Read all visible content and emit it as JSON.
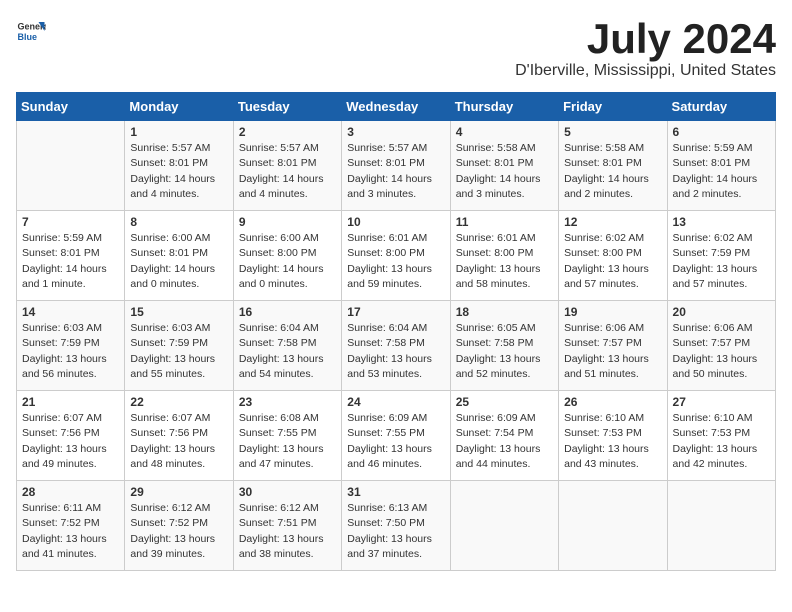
{
  "logo": {
    "general": "General",
    "blue": "Blue"
  },
  "header": {
    "title": "July 2024",
    "subtitle": "D'Iberville, Mississippi, United States"
  },
  "days_of_week": [
    "Sunday",
    "Monday",
    "Tuesday",
    "Wednesday",
    "Thursday",
    "Friday",
    "Saturday"
  ],
  "weeks": [
    [
      {
        "day": "",
        "sunrise": "",
        "sunset": "",
        "daylight": ""
      },
      {
        "day": "1",
        "sunrise": "Sunrise: 5:57 AM",
        "sunset": "Sunset: 8:01 PM",
        "daylight": "Daylight: 14 hours and 4 minutes."
      },
      {
        "day": "2",
        "sunrise": "Sunrise: 5:57 AM",
        "sunset": "Sunset: 8:01 PM",
        "daylight": "Daylight: 14 hours and 4 minutes."
      },
      {
        "day": "3",
        "sunrise": "Sunrise: 5:57 AM",
        "sunset": "Sunset: 8:01 PM",
        "daylight": "Daylight: 14 hours and 3 minutes."
      },
      {
        "day": "4",
        "sunrise": "Sunrise: 5:58 AM",
        "sunset": "Sunset: 8:01 PM",
        "daylight": "Daylight: 14 hours and 3 minutes."
      },
      {
        "day": "5",
        "sunrise": "Sunrise: 5:58 AM",
        "sunset": "Sunset: 8:01 PM",
        "daylight": "Daylight: 14 hours and 2 minutes."
      },
      {
        "day": "6",
        "sunrise": "Sunrise: 5:59 AM",
        "sunset": "Sunset: 8:01 PM",
        "daylight": "Daylight: 14 hours and 2 minutes."
      }
    ],
    [
      {
        "day": "7",
        "sunrise": "Sunrise: 5:59 AM",
        "sunset": "Sunset: 8:01 PM",
        "daylight": "Daylight: 14 hours and 1 minute."
      },
      {
        "day": "8",
        "sunrise": "Sunrise: 6:00 AM",
        "sunset": "Sunset: 8:01 PM",
        "daylight": "Daylight: 14 hours and 0 minutes."
      },
      {
        "day": "9",
        "sunrise": "Sunrise: 6:00 AM",
        "sunset": "Sunset: 8:00 PM",
        "daylight": "Daylight: 14 hours and 0 minutes."
      },
      {
        "day": "10",
        "sunrise": "Sunrise: 6:01 AM",
        "sunset": "Sunset: 8:00 PM",
        "daylight": "Daylight: 13 hours and 59 minutes."
      },
      {
        "day": "11",
        "sunrise": "Sunrise: 6:01 AM",
        "sunset": "Sunset: 8:00 PM",
        "daylight": "Daylight: 13 hours and 58 minutes."
      },
      {
        "day": "12",
        "sunrise": "Sunrise: 6:02 AM",
        "sunset": "Sunset: 8:00 PM",
        "daylight": "Daylight: 13 hours and 57 minutes."
      },
      {
        "day": "13",
        "sunrise": "Sunrise: 6:02 AM",
        "sunset": "Sunset: 7:59 PM",
        "daylight": "Daylight: 13 hours and 57 minutes."
      }
    ],
    [
      {
        "day": "14",
        "sunrise": "Sunrise: 6:03 AM",
        "sunset": "Sunset: 7:59 PM",
        "daylight": "Daylight: 13 hours and 56 minutes."
      },
      {
        "day": "15",
        "sunrise": "Sunrise: 6:03 AM",
        "sunset": "Sunset: 7:59 PM",
        "daylight": "Daylight: 13 hours and 55 minutes."
      },
      {
        "day": "16",
        "sunrise": "Sunrise: 6:04 AM",
        "sunset": "Sunset: 7:58 PM",
        "daylight": "Daylight: 13 hours and 54 minutes."
      },
      {
        "day": "17",
        "sunrise": "Sunrise: 6:04 AM",
        "sunset": "Sunset: 7:58 PM",
        "daylight": "Daylight: 13 hours and 53 minutes."
      },
      {
        "day": "18",
        "sunrise": "Sunrise: 6:05 AM",
        "sunset": "Sunset: 7:58 PM",
        "daylight": "Daylight: 13 hours and 52 minutes."
      },
      {
        "day": "19",
        "sunrise": "Sunrise: 6:06 AM",
        "sunset": "Sunset: 7:57 PM",
        "daylight": "Daylight: 13 hours and 51 minutes."
      },
      {
        "day": "20",
        "sunrise": "Sunrise: 6:06 AM",
        "sunset": "Sunset: 7:57 PM",
        "daylight": "Daylight: 13 hours and 50 minutes."
      }
    ],
    [
      {
        "day": "21",
        "sunrise": "Sunrise: 6:07 AM",
        "sunset": "Sunset: 7:56 PM",
        "daylight": "Daylight: 13 hours and 49 minutes."
      },
      {
        "day": "22",
        "sunrise": "Sunrise: 6:07 AM",
        "sunset": "Sunset: 7:56 PM",
        "daylight": "Daylight: 13 hours and 48 minutes."
      },
      {
        "day": "23",
        "sunrise": "Sunrise: 6:08 AM",
        "sunset": "Sunset: 7:55 PM",
        "daylight": "Daylight: 13 hours and 47 minutes."
      },
      {
        "day": "24",
        "sunrise": "Sunrise: 6:09 AM",
        "sunset": "Sunset: 7:55 PM",
        "daylight": "Daylight: 13 hours and 46 minutes."
      },
      {
        "day": "25",
        "sunrise": "Sunrise: 6:09 AM",
        "sunset": "Sunset: 7:54 PM",
        "daylight": "Daylight: 13 hours and 44 minutes."
      },
      {
        "day": "26",
        "sunrise": "Sunrise: 6:10 AM",
        "sunset": "Sunset: 7:53 PM",
        "daylight": "Daylight: 13 hours and 43 minutes."
      },
      {
        "day": "27",
        "sunrise": "Sunrise: 6:10 AM",
        "sunset": "Sunset: 7:53 PM",
        "daylight": "Daylight: 13 hours and 42 minutes."
      }
    ],
    [
      {
        "day": "28",
        "sunrise": "Sunrise: 6:11 AM",
        "sunset": "Sunset: 7:52 PM",
        "daylight": "Daylight: 13 hours and 41 minutes."
      },
      {
        "day": "29",
        "sunrise": "Sunrise: 6:12 AM",
        "sunset": "Sunset: 7:52 PM",
        "daylight": "Daylight: 13 hours and 39 minutes."
      },
      {
        "day": "30",
        "sunrise": "Sunrise: 6:12 AM",
        "sunset": "Sunset: 7:51 PM",
        "daylight": "Daylight: 13 hours and 38 minutes."
      },
      {
        "day": "31",
        "sunrise": "Sunrise: 6:13 AM",
        "sunset": "Sunset: 7:50 PM",
        "daylight": "Daylight: 13 hours and 37 minutes."
      },
      {
        "day": "",
        "sunrise": "",
        "sunset": "",
        "daylight": ""
      },
      {
        "day": "",
        "sunrise": "",
        "sunset": "",
        "daylight": ""
      },
      {
        "day": "",
        "sunrise": "",
        "sunset": "",
        "daylight": ""
      }
    ]
  ]
}
